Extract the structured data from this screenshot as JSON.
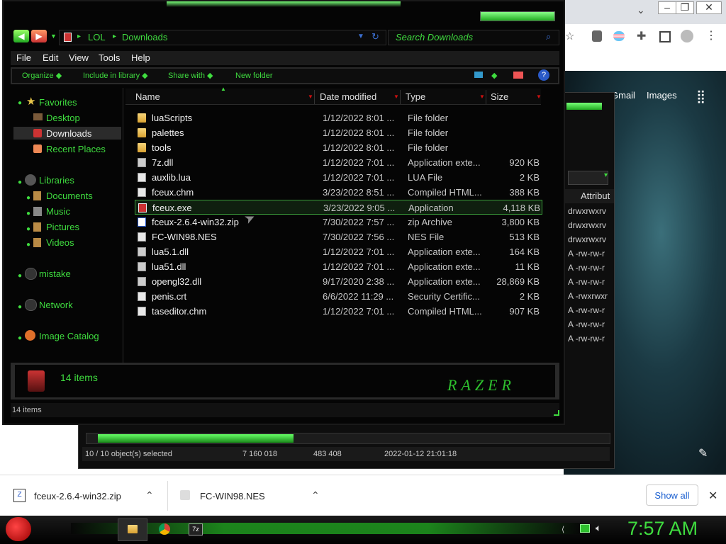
{
  "browser": {
    "links": [
      "Gmail",
      "Images"
    ],
    "minimize": "⌄",
    "bg_attr_header": "Attribut",
    "bg_attrs": [
      "drwxrwxrv",
      "drwxrwxrv",
      "drwxrwxrv",
      "A -rw-rw-r",
      "A -rw-rw-r",
      "A -rw-rw-r",
      "A -rwxrwxr",
      "A -rw-rw-r",
      "A -rw-rw-r",
      "A -rw-rw-r"
    ],
    "bg_status": {
      "selected": "10 / 10 object(s) selected",
      "size1": "7 160 018",
      "size2": "483 408",
      "date": "2022-01-12 21:01:18"
    }
  },
  "explorer": {
    "breadcrumb": [
      "LOL",
      "Downloads"
    ],
    "search_placeholder": "Search Downloads",
    "menu": [
      "File",
      "Edit",
      "View",
      "Tools",
      "Help"
    ],
    "toolbar": [
      "Organize",
      "Include in library",
      "Share with",
      "New folder"
    ],
    "nav": {
      "favorites": "Favorites",
      "favorites_items": [
        "Desktop",
        "Downloads",
        "Recent Places"
      ],
      "libraries": "Libraries",
      "libraries_items": [
        "Documents",
        "Music",
        "Pictures",
        "Videos"
      ],
      "mistake": "mistake",
      "network": "Network",
      "image_catalog": "Image Catalog"
    },
    "columns": [
      "Name",
      "Date modified",
      "Type",
      "Size"
    ],
    "files": [
      {
        "name": "luaScripts",
        "date": "1/12/2022 8:01 ...",
        "type": "File folder",
        "size": "",
        "icon": "folder"
      },
      {
        "name": "palettes",
        "date": "1/12/2022 8:01 ...",
        "type": "File folder",
        "size": "",
        "icon": "folder"
      },
      {
        "name": "tools",
        "date": "1/12/2022 8:01 ...",
        "type": "File folder",
        "size": "",
        "icon": "folder"
      },
      {
        "name": "7z.dll",
        "date": "1/12/2022 7:01 ...",
        "type": "Application exte...",
        "size": "920 KB",
        "icon": "dll"
      },
      {
        "name": "auxlib.lua",
        "date": "1/12/2022 7:01 ...",
        "type": "LUA File",
        "size": "2 KB",
        "icon": "doc"
      },
      {
        "name": "fceux.chm",
        "date": "3/23/2022 8:51 ...",
        "type": "Compiled HTML...",
        "size": "388 KB",
        "icon": "chm"
      },
      {
        "name": "fceux.exe",
        "date": "3/23/2022 9:05 ...",
        "type": "Application",
        "size": "4,118 KB",
        "icon": "exe"
      },
      {
        "name": "fceux-2.6.4-win32.zip",
        "date": "7/30/2022 7:57 ...",
        "type": "zip Archive",
        "size": "3,800 KB",
        "icon": "zip"
      },
      {
        "name": "FC-WIN98.NES",
        "date": "7/30/2022 7:56 ...",
        "type": "NES File",
        "size": "513 KB",
        "icon": "doc"
      },
      {
        "name": "lua5.1.dll",
        "date": "1/12/2022 7:01 ...",
        "type": "Application exte...",
        "size": "164 KB",
        "icon": "dll"
      },
      {
        "name": "lua51.dll",
        "date": "1/12/2022 7:01 ...",
        "type": "Application exte...",
        "size": "11 KB",
        "icon": "dll"
      },
      {
        "name": "opengl32.dll",
        "date": "9/17/2020 2:38 ...",
        "type": "Application exte...",
        "size": "28,869 KB",
        "icon": "dll"
      },
      {
        "name": "penis.crt",
        "date": "6/6/2022 11:29 ...",
        "type": "Security Certific...",
        "size": "2 KB",
        "icon": "doc"
      },
      {
        "name": "taseditor.chm",
        "date": "1/12/2022 7:01 ...",
        "type": "Compiled HTML...",
        "size": "907 KB",
        "icon": "chm"
      }
    ],
    "details_count": "14 items",
    "statusbar": "14 items"
  },
  "downloads": {
    "items": [
      "fceux-2.6.4-win32.zip",
      "FC-WIN98.NES"
    ],
    "show_all": "Show all",
    "close": "✕"
  },
  "taskbar": {
    "clock": "7:57 AM"
  },
  "colors": {
    "accent_green": "#3fdc3f",
    "selection": "#3a7a3a"
  }
}
